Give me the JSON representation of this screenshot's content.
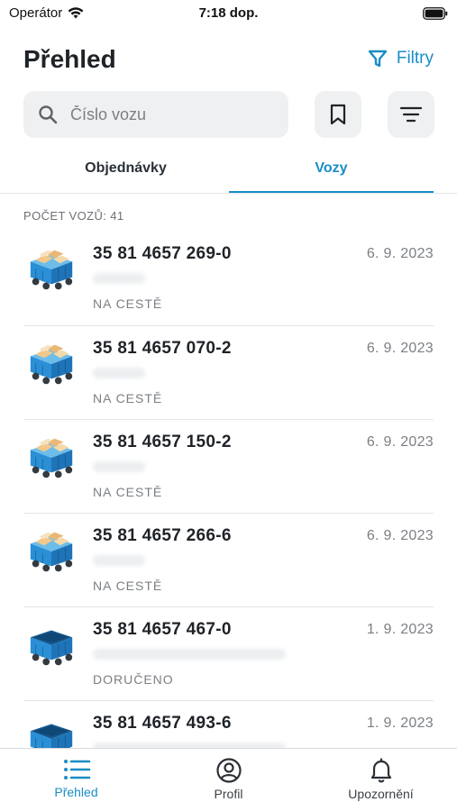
{
  "status_bar": {
    "carrier": "Operátor",
    "time": "7:18 dop."
  },
  "header": {
    "title": "Přehled",
    "filter_label": "Filtry"
  },
  "search": {
    "placeholder": "Číslo vozu",
    "value": ""
  },
  "tabs": [
    {
      "label": "Objednávky"
    },
    {
      "label": "Vozy"
    }
  ],
  "count_label": "POČET VOZŮ: 41",
  "items": [
    {
      "number": "35 81 4657 269-0",
      "date": "6. 9. 2023",
      "status": "NA CESTĚ",
      "icon": "loaded-wagon-icon"
    },
    {
      "number": "35 81 4657 070-2",
      "date": "6. 9. 2023",
      "status": "NA CESTĚ",
      "icon": "loaded-wagon-icon"
    },
    {
      "number": "35 81 4657 150-2",
      "date": "6. 9. 2023",
      "status": "NA CESTĚ",
      "icon": "loaded-wagon-icon"
    },
    {
      "number": "35 81 4657 266-6",
      "date": "6. 9. 2023",
      "status": "NA CESTĚ",
      "icon": "loaded-wagon-icon"
    },
    {
      "number": "35 81 4657 467-0",
      "date": "1. 9. 2023",
      "status": "DORUČENO",
      "icon": "empty-wagon-icon"
    },
    {
      "number": "35 81 4657 493-6",
      "date": "1. 9. 2023",
      "status": "",
      "icon": "empty-wagon-icon"
    }
  ],
  "tab_bar": [
    {
      "label": "Přehled",
      "icon": "list-icon"
    },
    {
      "label": "Profil",
      "icon": "profile-icon"
    },
    {
      "label": "Upozornění",
      "icon": "bell-icon"
    }
  ],
  "colors": {
    "accent": "#1a8dc6",
    "wagon": "#2b8fd6",
    "cargo": "#f2c98a"
  }
}
